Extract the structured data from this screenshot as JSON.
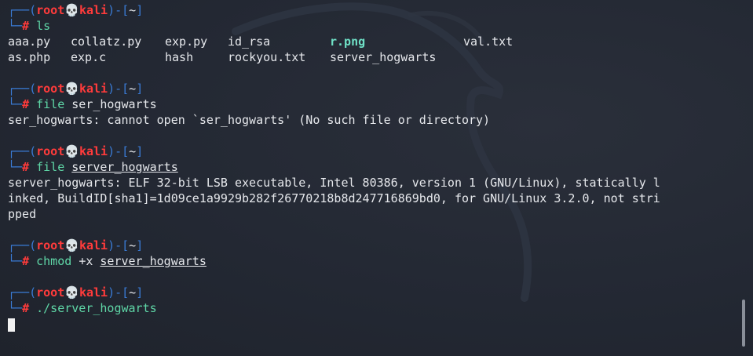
{
  "prompt": {
    "open": "┌──(",
    "user": "root",
    "skull": "💀",
    "host": "kali",
    "mid": ")-[",
    "dir": "~",
    "close": "]",
    "second": "└─",
    "hash": "#"
  },
  "block1": {
    "cmd": "ls",
    "files_row1": [
      "aaa.py",
      "collatz.py",
      "exp.py",
      "id_rsa",
      "r.png",
      "val.txt"
    ],
    "files_row2": [
      "as.php",
      "exp.c",
      "hash",
      "rockyou.txt",
      "server_hogwarts",
      ""
    ]
  },
  "block2": {
    "cmd": "file",
    "arg": "ser_hogwarts",
    "out": "ser_hogwarts: cannot open `ser_hogwarts' (No such file or directory)"
  },
  "block3": {
    "cmd": "file",
    "arg": "server_hogwarts",
    "out1": "server_hogwarts: ELF 32-bit LSB executable, Intel 80386, version 1 (GNU/Linux), statically l",
    "out2": "inked, BuildID[sha1]=1d09ce1a9929b282f26770218b8d247716869bd0, for GNU/Linux 3.2.0, not stri",
    "out3": "pped"
  },
  "block4": {
    "cmd": "chmod",
    "flag": "+x",
    "arg": "server_hogwarts"
  },
  "block5": {
    "cmd": "./server_hogwarts"
  },
  "colors": {
    "background": "#232833",
    "prompt_frame": "#3a7bd5",
    "prompt_user": "#ff3b3b",
    "command": "#5fd7a7",
    "image_file": "#6fe0c6"
  },
  "icons": {
    "skull": "skull-icon"
  }
}
